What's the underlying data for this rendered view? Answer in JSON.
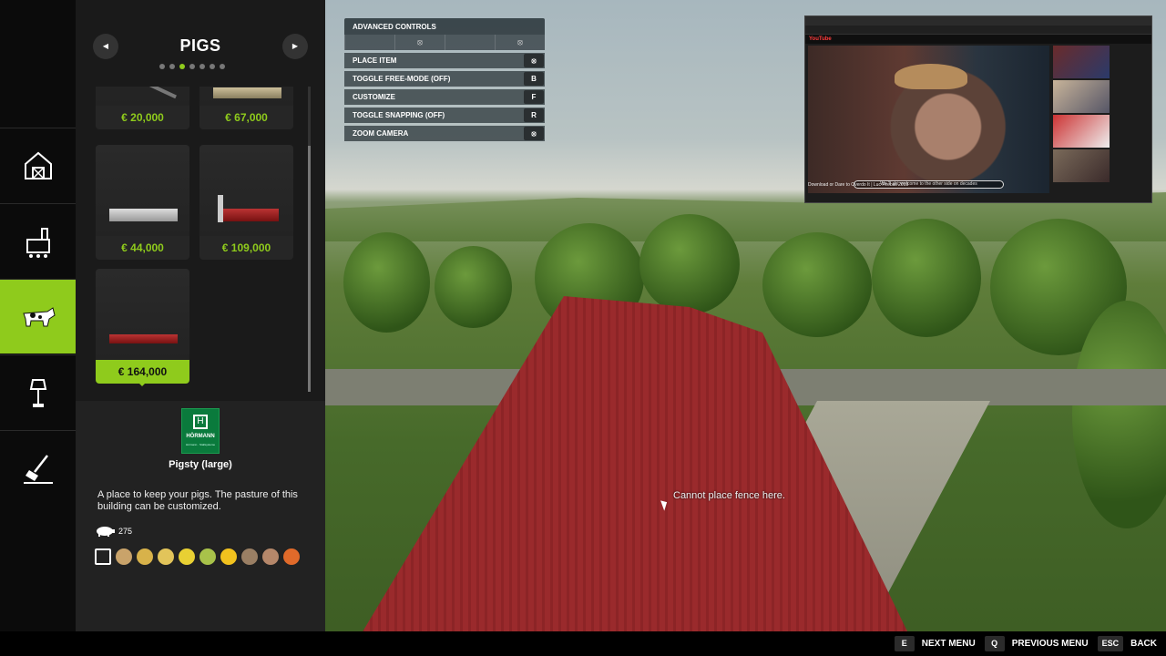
{
  "world": {
    "message": "Cannot place fence here."
  },
  "controls": {
    "title": "ADVANCED CONTROLS",
    "items": [
      {
        "label": "PLACE ITEM",
        "key": "⦻"
      },
      {
        "label": "TOGGLE FREE-MODE (OFF)",
        "key": "B"
      },
      {
        "label": "CUSTOMIZE",
        "key": "F"
      },
      {
        "label": "TOGGLE SNAPPING (OFF)",
        "key": "R"
      },
      {
        "label": "ZOOM CAMERA",
        "key": "⦻"
      }
    ]
  },
  "store": {
    "category": "PIGS",
    "prev_label": "◀",
    "next_label": "▶",
    "items": [
      {
        "price": "€ 20,000"
      },
      {
        "price": "€ 67,000"
      },
      {
        "price": "€ 44,000"
      },
      {
        "price": "€ 109,000"
      },
      {
        "price": "€ 164,000"
      }
    ],
    "selected": {
      "brand": "HÖRMANN",
      "brand_sub": "Hörmann · Stallsysteme",
      "name": "Pigsty (large)",
      "description": "A place to keep your pigs. The pasture of this building can be customized.",
      "capacity": "275"
    }
  },
  "footer": [
    {
      "key": "E",
      "label": "NEXT MENU"
    },
    {
      "key": "Q",
      "label": "PREVIOUS MENU"
    },
    {
      "key": "ESC",
      "label": "BACK"
    }
  ],
  "stream": {
    "logo": "YouTube",
    "video_title": "Download or Dare to Overdo It | Luc Fireball 2019",
    "subtitle": "We 'll ski, welcome to the other side on decades"
  },
  "colors": {
    "accent": "#8fcb1c",
    "roof": "#9a2a2c",
    "brand": "#0a7a3c"
  }
}
